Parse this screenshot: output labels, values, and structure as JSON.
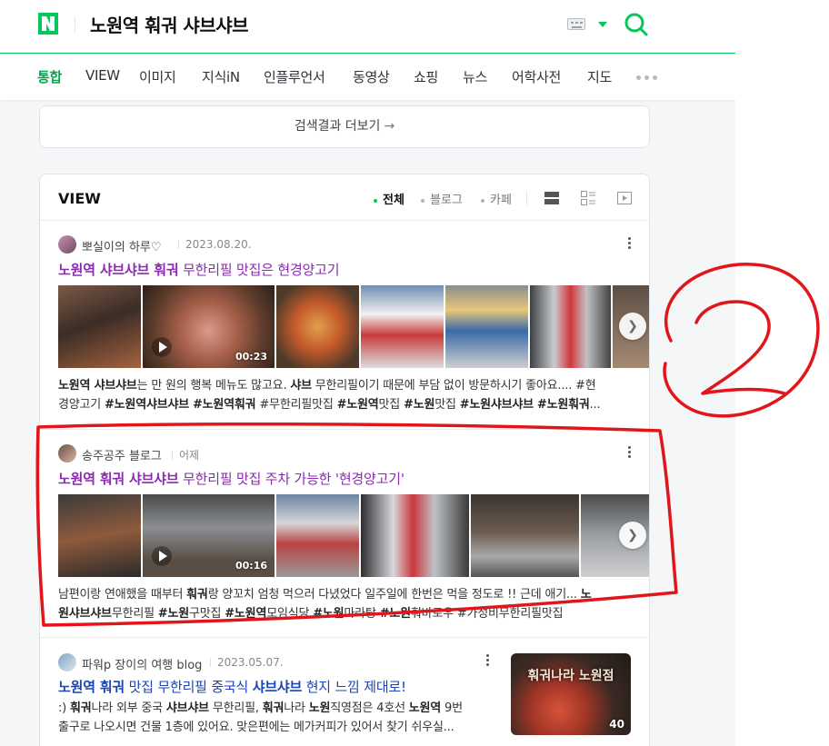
{
  "header": {
    "logo_letter": "N",
    "query": "노원역 훠궈 샤브샤브",
    "brand_color": "#03c75a"
  },
  "tabs": [
    {
      "label": "통합",
      "active": true
    },
    {
      "label": "VIEW"
    },
    {
      "label": "이미지"
    },
    {
      "label": "지식iN"
    },
    {
      "label": "인플루언서"
    },
    {
      "label": "동영상"
    },
    {
      "label": "쇼핑"
    },
    {
      "label": "뉴스"
    },
    {
      "label": "어학사전"
    },
    {
      "label": "지도"
    }
  ],
  "more_results": {
    "label": "검색결과 더보기",
    "arrow": "→"
  },
  "view": {
    "title": "VIEW",
    "filters": [
      {
        "label": "전체",
        "active": true
      },
      {
        "label": "블로그"
      },
      {
        "label": "카페"
      }
    ]
  },
  "posts": [
    {
      "author": "뽀실이의 하루♡",
      "date": "2023.08.20.",
      "title_parts": [
        "노원역 샤브샤브 훠궈",
        " 무한리필 맛집은 현경양고기"
      ],
      "video_duration": "00:23",
      "desc_line1_parts": [
        "노원역 샤브샤브",
        "는 만 원의 행복 메뉴도 많고요. ",
        "샤브",
        " 무한리필이기 때문에 부담 없이 방문하시기 좋아요.... #현"
      ],
      "desc_line2_parts": [
        "경양고기 ",
        "#노원역샤브샤브",
        " ",
        "#노원역훠궈",
        " #무한리필맛집 ",
        "#노원역",
        "맛집 ",
        "#노원",
        "맛집 ",
        "#노원샤브샤브",
        " ",
        "#노원훠궈",
        "..."
      ]
    },
    {
      "author": "송주공주 블로그",
      "date": "어제",
      "title_parts": [
        "노원역 훠궈 샤브샤브",
        " 무한리필 맛집 주차 가능한 '현경양고기'"
      ],
      "video_duration": "00:16",
      "desc_line1_parts": [
        "남편이랑 연애했을 때부터 ",
        "훠궈",
        "랑 양꼬치 엄청 먹으러 다녔었다 일주일에 한번은 먹을 정도로 !! 근데 애기... ",
        "노"
      ],
      "desc_line2_parts": [
        "원샤브샤브",
        "무한리필 ",
        "#노원",
        "구맛집 ",
        "#노원역",
        "모임식당 ",
        "#노원",
        "마라탕 ",
        "#노원",
        "훠바로우 #가성비무한리필맛집"
      ]
    },
    {
      "author": "파워p 장이의 여행 blog",
      "date": "2023.05.07.",
      "title_parts": [
        "노원역 훠궈",
        " 맛집 무한리필 중국식 ",
        "샤브샤브",
        " 현지 느낌 제대로!"
      ],
      "desc_line1_parts": [
        ":) ",
        "훠궈",
        "나라 외부 중국 ",
        "샤브샤브",
        " 무한리필, ",
        "훠궈",
        "나라 ",
        "노원",
        "직영점은 4호선 ",
        "노원역",
        " 9번"
      ],
      "desc_line2": "출구로 나오시면 건물 1층에 있어요. 맞은편에는 메가커피가 있어서 찾기 쉬우실...",
      "image_sign_text": "훠궈나라 노원점",
      "image_count": "40"
    }
  ],
  "annotation": {
    "number": "2",
    "color": "#e0161b"
  }
}
